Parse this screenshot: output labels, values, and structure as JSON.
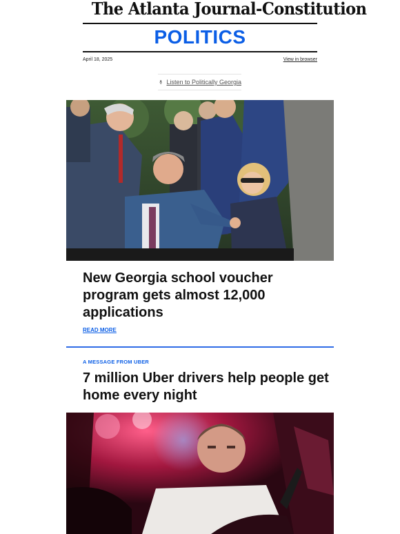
{
  "masthead": {
    "title": "The Atlanta Journal-Constitution"
  },
  "section": {
    "title": "POLITICS"
  },
  "meta": {
    "date": "April 18, 2025",
    "view_in_browser": "View in browser"
  },
  "podcast": {
    "label": "Listen to Politically Georgia",
    "icon": "microphone-icon"
  },
  "story": {
    "headline": "New Georgia school voucher program gets almost 12,000 applications",
    "read_more": "READ MORE"
  },
  "sponsor": {
    "label": "A MESSAGE FROM UBER",
    "headline": "7 million Uber drivers help people get home every night"
  },
  "colors": {
    "accent": "#0b5ee6",
    "divider": "#2e6be6",
    "text": "#111111"
  }
}
